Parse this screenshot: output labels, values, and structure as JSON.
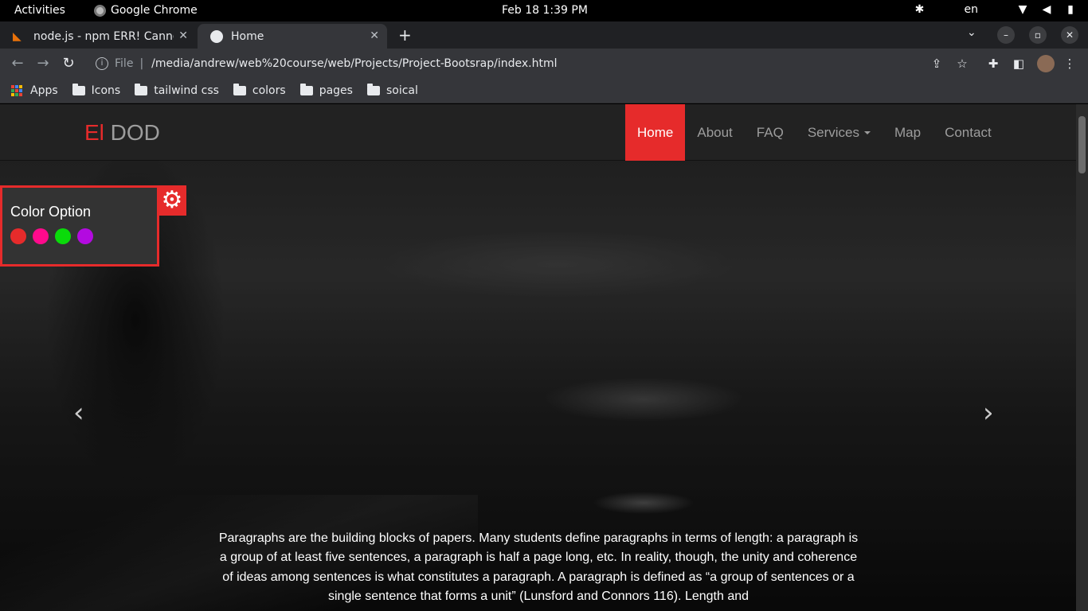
{
  "os_bar": {
    "activities": "Activities",
    "app_name": "Google Chrome",
    "clock": "Feb 18  1:39 PM",
    "language": "en"
  },
  "browser": {
    "tabs": [
      {
        "title": "node.js - npm ERR! Cannot",
        "icon": "stackoverflow-icon"
      },
      {
        "title": "Home",
        "icon": "globe-icon",
        "active": true
      }
    ],
    "address": {
      "scheme": "File",
      "path": "/media/andrew/web%20course/web/Projects/Project-Bootsrap/index.html"
    },
    "bookmarks": [
      {
        "label": "Apps",
        "icon": "apps-grid-icon"
      },
      {
        "label": "Icons",
        "icon": "folder-icon"
      },
      {
        "label": "tailwind css",
        "icon": "folder-icon"
      },
      {
        "label": "colors",
        "icon": "folder-icon"
      },
      {
        "label": "pages",
        "icon": "folder-icon"
      },
      {
        "label": "soical",
        "icon": "folder-icon"
      }
    ]
  },
  "site": {
    "brand": {
      "accent": "El",
      "rest": " DOD"
    },
    "menu": [
      {
        "label": "Home",
        "active": true
      },
      {
        "label": "About"
      },
      {
        "label": "FAQ"
      },
      {
        "label": "Services",
        "dropdown": true
      },
      {
        "label": "Map"
      },
      {
        "label": "Contact"
      }
    ],
    "color_option": {
      "title": "Color Option",
      "swatches": [
        "#e62b2b",
        "#ff0a8c",
        "#0adb0a",
        "#b30ae0"
      ]
    },
    "carousel": {
      "prev_glyph": "‹",
      "next_glyph": "›",
      "caption": "Paragraphs are the building blocks of papers. Many students define paragraphs in terms of length: a paragraph is a group of at least five sentences, a paragraph is half a page long, etc. In reality, though, the unity and coherence of ideas among sentences is what constitutes a paragraph. A paragraph is defined as “a group of sentences or a single sentence that forms a unit” (Lunsford and Connors 116). Length and"
    },
    "accent_color": "#e62b2b"
  }
}
